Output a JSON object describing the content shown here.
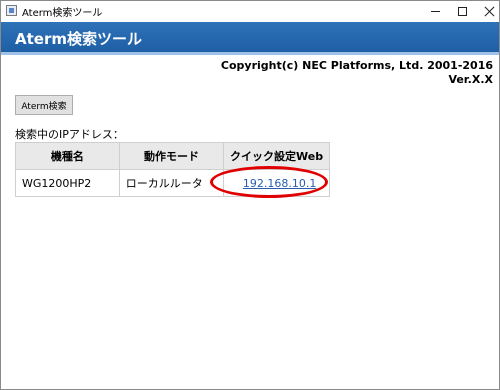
{
  "window": {
    "title": "Aterm検索ツール"
  },
  "header": {
    "title": "Aterm検索ツール"
  },
  "copyright": "Copyright(c) NEC Platforms, Ltd. 2001-2016",
  "version": "Ver.X.X",
  "search_button_label": "Aterm検索",
  "ip_label": "検索中のIPアドレス：",
  "table": {
    "headers": [
      "機種名",
      "動作モード",
      "クイック設定Web"
    ],
    "rows": [
      {
        "model": "WG1200HP2",
        "mode": "ローカルルータ",
        "link": "192.168.10.1"
      }
    ]
  },
  "highlight_color": "#e00000",
  "header_color": "#1e5fa6"
}
